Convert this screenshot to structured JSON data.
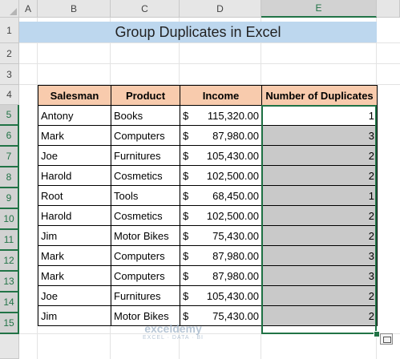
{
  "columns": [
    "A",
    "B",
    "C",
    "D",
    "E"
  ],
  "rows": [
    "1",
    "2",
    "3",
    "4",
    "5",
    "6",
    "7",
    "8",
    "9",
    "10",
    "11",
    "12",
    "13",
    "14",
    "15"
  ],
  "title": "Group Duplicates in Excel",
  "table": {
    "headers": [
      "Salesman",
      "Product",
      "Income",
      "Number of Duplicates"
    ],
    "currency": "$",
    "rows": [
      {
        "salesman": "Antony",
        "product": "Books",
        "income": "115,320.00",
        "dups": "1"
      },
      {
        "salesman": "Mark",
        "product": "Computers",
        "income": "87,980.00",
        "dups": "3"
      },
      {
        "salesman": "Joe",
        "product": "Furnitures",
        "income": "105,430.00",
        "dups": "2"
      },
      {
        "salesman": "Harold",
        "product": "Cosmetics",
        "income": "102,500.00",
        "dups": "2"
      },
      {
        "salesman": "Root",
        "product": "Tools",
        "income": "68,450.00",
        "dups": "1"
      },
      {
        "salesman": "Harold",
        "product": "Cosmetics",
        "income": "102,500.00",
        "dups": "2"
      },
      {
        "salesman": "Jim",
        "product": "Motor Bikes",
        "income": "75,430.00",
        "dups": "2"
      },
      {
        "salesman": "Mark",
        "product": "Computers",
        "income": "87,980.00",
        "dups": "3"
      },
      {
        "salesman": "Mark",
        "product": "Computers",
        "income": "87,980.00",
        "dups": "3"
      },
      {
        "salesman": "Joe",
        "product": "Furnitures",
        "income": "105,430.00",
        "dups": "2"
      },
      {
        "salesman": "Jim",
        "product": "Motor Bikes",
        "income": "75,430.00",
        "dups": "2"
      }
    ]
  },
  "watermark": {
    "main": "exceldemy",
    "sub": "EXCEL · DATA · BI"
  },
  "colors": {
    "title_fill": "#bdd7ee",
    "header_fill": "#f8cbad",
    "selection": "#217346",
    "selected_fill": "#c9c9c9"
  },
  "icons": {
    "quick_analysis": "quick-analysis-icon"
  }
}
